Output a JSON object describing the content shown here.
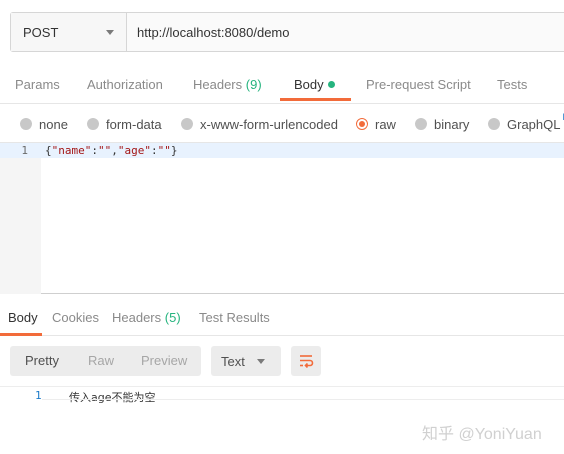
{
  "request": {
    "method": "POST",
    "url": "http://localhost:8080/demo"
  },
  "request_tabs": [
    {
      "label": "Params"
    },
    {
      "label": "Authorization"
    },
    {
      "label": "Headers",
      "count": "(9)"
    },
    {
      "label": "Body",
      "active": true
    },
    {
      "label": "Pre-request Script"
    },
    {
      "label": "Tests"
    }
  ],
  "body_options": [
    {
      "label": "none"
    },
    {
      "label": "form-data"
    },
    {
      "label": "x-www-form-urlencoded"
    },
    {
      "label": "raw",
      "selected": true
    },
    {
      "label": "binary"
    },
    {
      "label": "GraphQL",
      "badge": "B"
    }
  ],
  "editor": {
    "line_number": "1",
    "code_parts": [
      "{",
      "\"name\"",
      ":",
      "\"\"",
      ",",
      "\"age\"",
      ":",
      "\"\"",
      "}"
    ]
  },
  "response_tabs": [
    {
      "label": "Body",
      "active": true
    },
    {
      "label": "Cookies"
    },
    {
      "label": "Headers",
      "count": "(5)"
    },
    {
      "label": "Test Results"
    }
  ],
  "response_toolbar": {
    "view_modes": [
      "Pretty",
      "Raw",
      "Preview"
    ],
    "format": "Text"
  },
  "response_body": {
    "line_number": "1",
    "text": "传入age不能为空"
  },
  "watermark": "知乎 @YoniYuan",
  "colors": {
    "accent": "#f26b3a",
    "count_green": "#26b47f"
  }
}
